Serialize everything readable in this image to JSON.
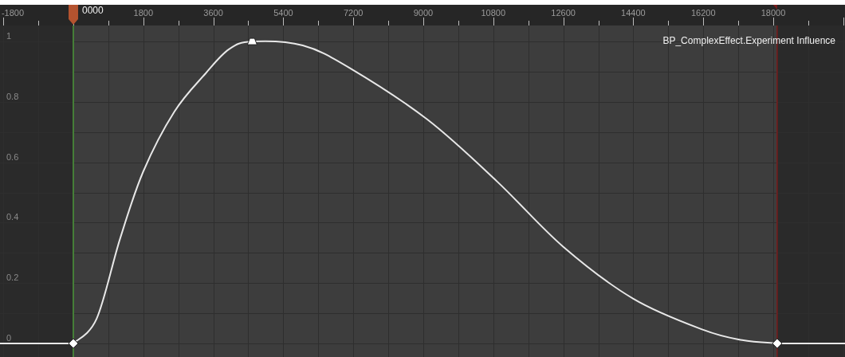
{
  "curve_editor": {
    "playhead": {
      "label": "0000"
    },
    "chart_data": {
      "type": "line",
      "grid": true,
      "xlim": [
        -1886,
        19845
      ],
      "ylim": [
        -0.045,
        1.053
      ],
      "xticks": [
        -1800,
        1800,
        3600,
        5400,
        7200,
        9000,
        10800,
        12600,
        14400,
        16200,
        18000
      ],
      "yticks": [
        0,
        0.2,
        0.4,
        0.6,
        0.8,
        1
      ],
      "x": [
        -1886,
        0,
        600,
        1200,
        1800,
        2600,
        3400,
        4000,
        4600,
        5900,
        7100,
        9100,
        10900,
        12600,
        14400,
        16200,
        17200,
        18100,
        19845
      ],
      "series": [
        {
          "name": "BP_ComplexEffect.Experiment Influence",
          "color": "#e8e8e8",
          "values": [
            0,
            0,
            0.082,
            0.346,
            0.57,
            0.768,
            0.894,
            0.974,
            1,
            0.987,
            0.913,
            0.742,
            0.536,
            0.32,
            0.148,
            0.045,
            0.011,
            0,
            0
          ]
        }
      ],
      "ref_lines": [
        {
          "axis": "x",
          "value": 0,
          "color": "#4f9a3c"
        },
        {
          "axis": "x",
          "value": 18100,
          "color": "#7a1c1c"
        }
      ],
      "bands": [
        {
          "axis": "x",
          "from": 0,
          "to": 18100,
          "color": "#3d3d3d"
        }
      ]
    }
  }
}
